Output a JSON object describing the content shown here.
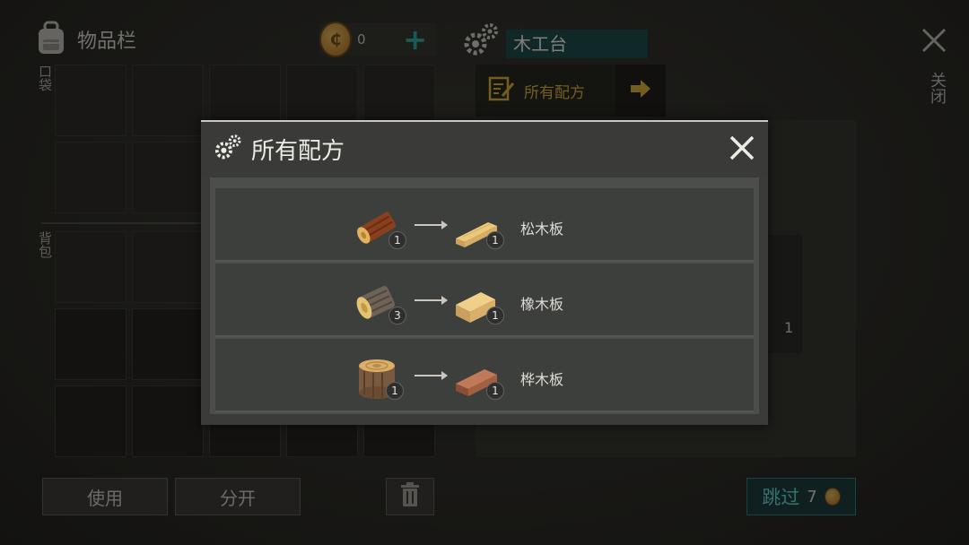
{
  "inventory": {
    "title": "物品栏",
    "coin_count": "0",
    "add_label": "+",
    "pocket_label": "口袋",
    "backpack_label": "背包",
    "use_label": "使用",
    "split_label": "分开"
  },
  "workbench": {
    "name": "木工台",
    "recipes_label": "所有配方",
    "output_count": "1"
  },
  "close_label": "关闭",
  "skip": {
    "label": "跳过",
    "cost": "7"
  },
  "modal": {
    "title": "所有配方",
    "recipes": [
      {
        "input_icon": "pine-log-icon",
        "input_count": "1",
        "output_icon": "pine-plank-icon",
        "output_count": "1",
        "name": "松木板"
      },
      {
        "input_icon": "oak-log-icon",
        "input_count": "3",
        "output_icon": "oak-plank-icon",
        "output_count": "1",
        "name": "橡木板"
      },
      {
        "input_icon": "birch-log-icon",
        "input_count": "1",
        "output_icon": "birch-plank-icon",
        "output_count": "1",
        "name": "桦木板"
      }
    ]
  },
  "colors": {
    "accent_teal": "#2aa6a0",
    "recipe_gold": "#d1aa3a"
  }
}
